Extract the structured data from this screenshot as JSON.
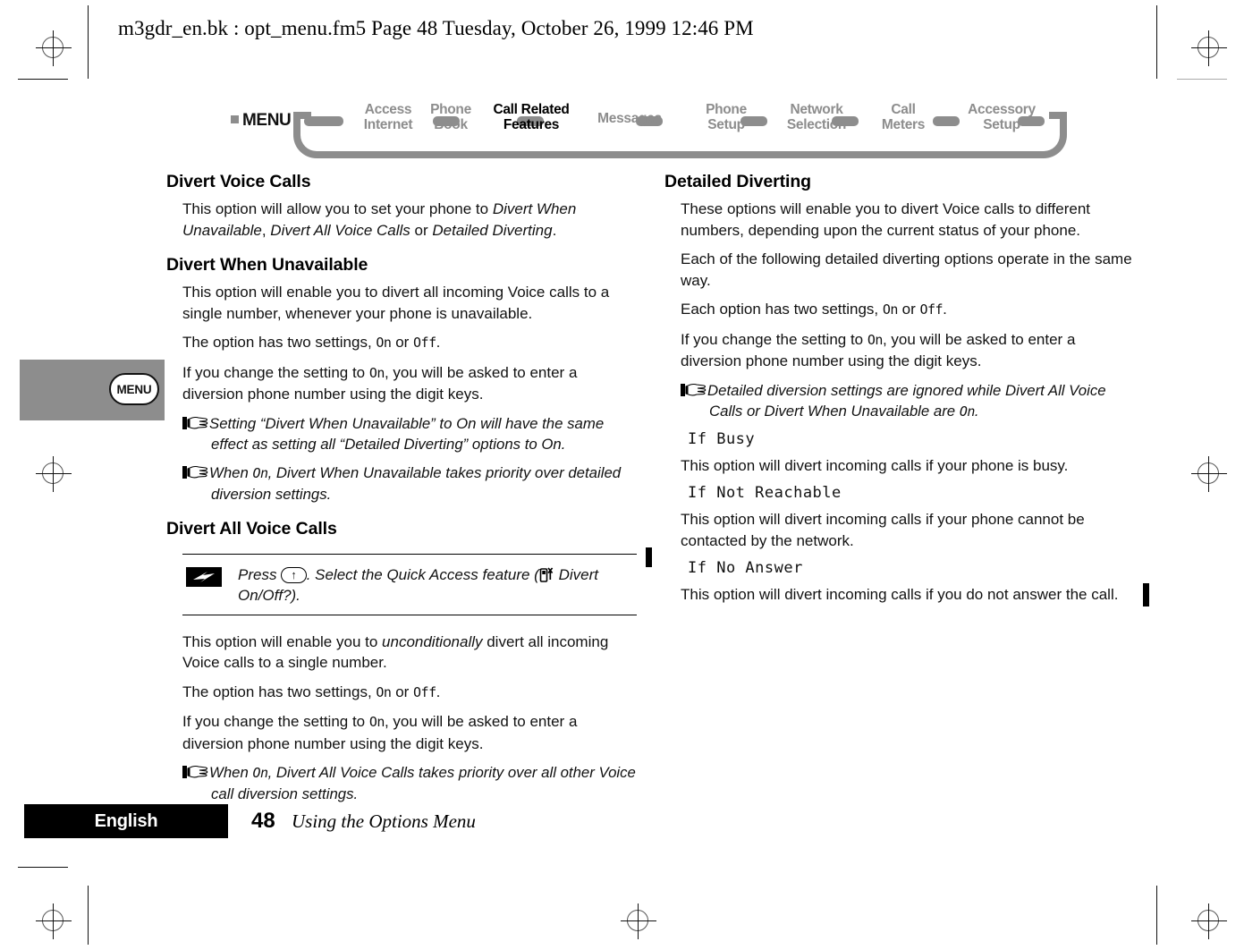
{
  "header": {
    "running_head": "m3gdr_en.bk : opt_menu.fm5  Page 48  Tuesday, October 26, 1999  12:46 PM"
  },
  "nav": {
    "menu_label": "MENU",
    "items": [
      {
        "line1": "Access",
        "line2": "Internet",
        "active": false
      },
      {
        "line1": "Phone",
        "line2": "Book",
        "active": false
      },
      {
        "line1": "Call Related",
        "line2": "Features",
        "active": true
      },
      {
        "line1": "Messages",
        "line2": "",
        "active": false
      },
      {
        "line1": "Phone",
        "line2": "Setup",
        "active": false
      },
      {
        "line1": "Network",
        "line2": "Selection",
        "active": false
      },
      {
        "line1": "Call",
        "line2": "Meters",
        "active": false
      },
      {
        "line1": "Accessory",
        "line2": "Setup",
        "active": false
      }
    ]
  },
  "side_tab": {
    "label": "MENU"
  },
  "left_column": {
    "h_divert_voice_calls": "Divert Voice Calls",
    "p_intro_a": "This option will allow you to set your phone to ",
    "p_intro_i1": "Divert When Unavailable",
    "p_intro_b": ", ",
    "p_intro_i2": "Divert All Voice Calls",
    "p_intro_c": " or ",
    "p_intro_i3": "Detailed Diverting",
    "p_intro_d": ".",
    "h_divert_when_unavailable": "Divert When Unavailable",
    "p_dwu_1": "This option will enable you to divert all incoming Voice calls to a single number, whenever your phone is unavailable.",
    "p_dwu_2a": "The option has two settings, ",
    "p_dwu_2_on": "On",
    "p_dwu_2b": " or ",
    "p_dwu_2_off": "Off",
    "p_dwu_2c": ".",
    "p_dwu_3a": "If you change the setting to ",
    "p_dwu_3_on": "On",
    "p_dwu_3b": ", you will be asked to enter a diversion phone number using the digit keys.",
    "note_1": "Setting “Divert When Unavailable” to On will have the same effect as setting all “Detailed Diverting” options to On.",
    "note_2a": "When ",
    "note_2_on": "On",
    "note_2b": ", Divert When Unavailable takes priority over detailed diversion settings.",
    "h_divert_all_voice_calls": "Divert All Voice Calls",
    "callout_a": "Press ",
    "callout_key": "↑",
    "callout_b": ". Select the Quick Access feature (",
    "callout_c": " Divert On/Off?).",
    "p_davc_1a": "This option will enable you to ",
    "p_davc_1_i": "unconditionally",
    "p_davc_1b": " divert all incoming Voice calls to a single number.",
    "p_davc_2a": "The option has two settings, ",
    "p_davc_2_on": "On",
    "p_davc_2b": " or ",
    "p_davc_2_off": "Off",
    "p_davc_2c": ".",
    "p_davc_3a": "If you change the setting to ",
    "p_davc_3_on": "On",
    "p_davc_3b": ", you will be asked to enter a diversion phone number using the digit keys.",
    "note_3a": "When ",
    "note_3_on": "On",
    "note_3b": ", Divert All Voice Calls takes priority over all other Voice call diversion settings."
  },
  "right_column": {
    "h_detailed_diverting": "Detailed Diverting",
    "p_dd_1": "These options will enable you to divert Voice calls to different numbers, depending upon the current status of your phone.",
    "p_dd_2": "Each of the following detailed diverting options operate in the same way.",
    "p_dd_3a": "Each option has two settings, ",
    "p_dd_3_on": "On",
    "p_dd_3b": " or ",
    "p_dd_3_off": "Off",
    "p_dd_3c": ".",
    "p_dd_4a": "If you change the setting to ",
    "p_dd_4_on": "On",
    "p_dd_4b": ", you will be asked to enter a diversion phone number using the digit keys.",
    "note_4a": "Detailed diversion settings are ignored while Divert All Voice Calls or Divert When Unavailable are ",
    "note_4_on": "On",
    "note_4b": ".",
    "lcd_if_busy": "If Busy",
    "p_if_busy": "This option will divert incoming calls if your phone is busy.",
    "lcd_if_not_reachable": "If Not Reachable",
    "p_if_not_reachable": "This option will divert incoming calls if your phone cannot be contacted by the network.",
    "lcd_if_no_answer": "If No Answer",
    "p_if_no_answer": "This option will divert incoming calls if you do not answer the call."
  },
  "footer": {
    "language": "English",
    "page_number": "48",
    "section_title": "Using the Options Menu"
  },
  "colors": {
    "nav_gray": "#8d8d8d",
    "ink": "#000000",
    "paper": "#ffffff"
  }
}
